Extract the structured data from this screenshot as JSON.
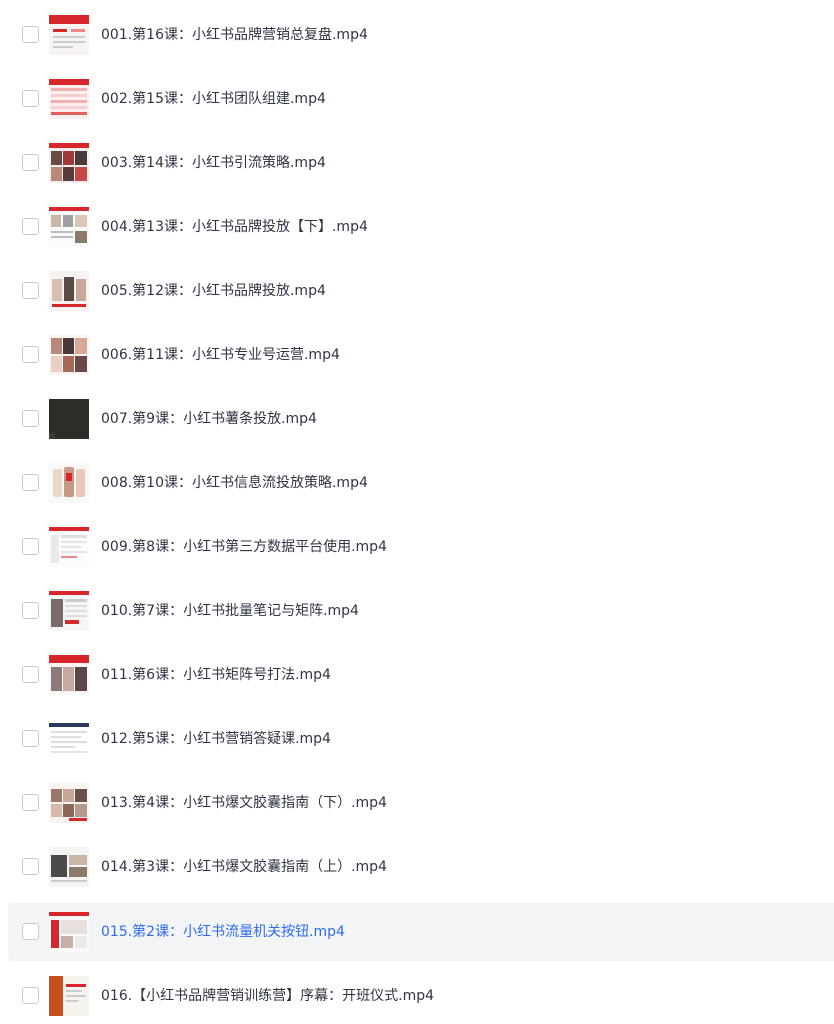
{
  "files": [
    {
      "name": "001.第16课：小红书品牌营销总复盘.mp4",
      "thumbnail": "slide-red-header-thumbnail"
    },
    {
      "name": "002.第15课：小红书团队组建.mp4",
      "thumbnail": "slide-red-table-thumbnail"
    },
    {
      "name": "003.第14课：小红书引流策略.mp4",
      "thumbnail": "slide-dark-photos-thumbnail"
    },
    {
      "name": "004.第13课：小红书品牌投放【下】.mp4",
      "thumbnail": "slide-white-grid-thumbnail"
    },
    {
      "name": "005.第12课：小红书品牌投放.mp4",
      "thumbnail": "slide-portraits-thumbnail"
    },
    {
      "name": "006.第11课：小红书专业号运营.mp4",
      "thumbnail": "slide-profile-cards-thumbnail"
    },
    {
      "name": "007.第9课：小红书薯条投放.mp4",
      "thumbnail": "dark-video-frame-thumbnail"
    },
    {
      "name": "008.第10课：小红书信息流投放策略.mp4",
      "thumbnail": "slide-phone-screens-thumbnail"
    },
    {
      "name": "009.第8课：小红书第三方数据平台使用.mp4",
      "thumbnail": "slide-dashboard-thumbnail"
    },
    {
      "name": "010.第7课：小红书批量笔记与矩阵.mp4",
      "thumbnail": "slide-notes-thumbnail"
    },
    {
      "name": "011.第6课：小红书矩阵号打法.mp4",
      "thumbnail": "slide-matrix-thumbnail"
    },
    {
      "name": "012.第5课：小红书营销答疑课.mp4",
      "thumbnail": "slide-document-thumbnail"
    },
    {
      "name": "013.第4课：小红书爆文胶囊指南（下）.mp4",
      "thumbnail": "slide-photo-grid-thumbnail"
    },
    {
      "name": "014.第3课：小红书爆文胶囊指南（上）.mp4",
      "thumbnail": "slide-photo-collage-thumbnail"
    },
    {
      "name": "015.第2课：小红书流量机关按钮.mp4",
      "thumbnail": "slide-screenshot-thumbnail"
    },
    {
      "name": "016.【小红书品牌营销训练营】序幕：开班仪式.mp4",
      "thumbnail": "orange-cover-thumbnail"
    }
  ],
  "highlighted_index": 14,
  "colors": {
    "text": "#2f3542",
    "highlight_text": "#2f6bf0",
    "highlight_background": "#f3f4f6",
    "brand_red": "#d8262d"
  }
}
